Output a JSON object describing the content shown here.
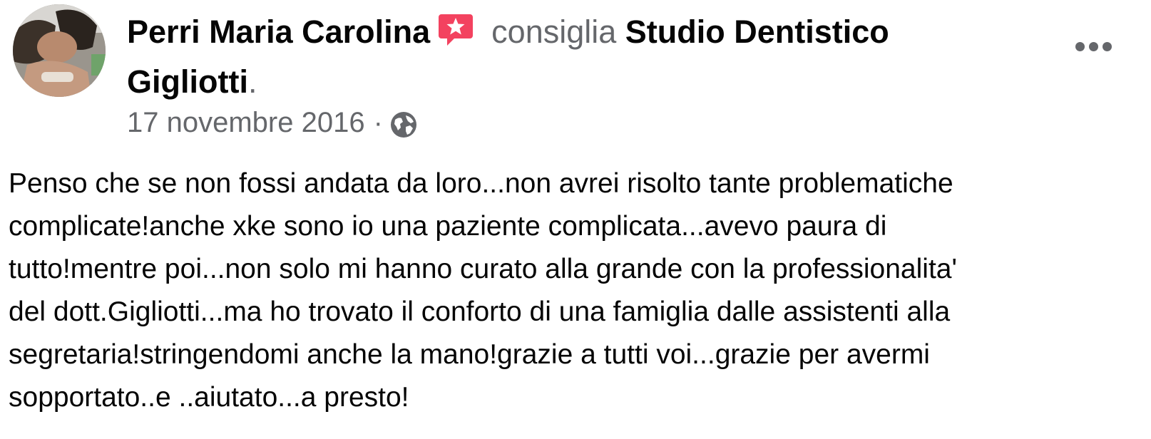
{
  "post": {
    "author": "Perri Maria Carolina",
    "verb": "consiglia",
    "page_name_line1": "Studio Dentistico",
    "page_name_line2": "Gigliotti",
    "page_period": ".",
    "date": "17 novembre 2016",
    "separator": "·",
    "privacy_icon": "globe-icon",
    "recommend_icon": "recommend-star-icon",
    "accent_color": "#f3425f",
    "more_icon": "more-options-icon",
    "text_lines": [
      "Penso che se non fossi andata da loro...non avrei risolto tante problematiche",
      "complicate!anche xke sono io una paziente complicata...avevo paura di",
      "tutto!mentre poi...non solo mi hanno curato alla grande con la professionalita'",
      "del dott.Gigliotti...ma ho trovato il conforto di una famiglia dalle assistenti alla",
      "segretaria!stringendomi anche la mano!grazie a tutti voi...grazie per avermi",
      "sopportato..e ..aiutato...a presto!"
    ]
  }
}
